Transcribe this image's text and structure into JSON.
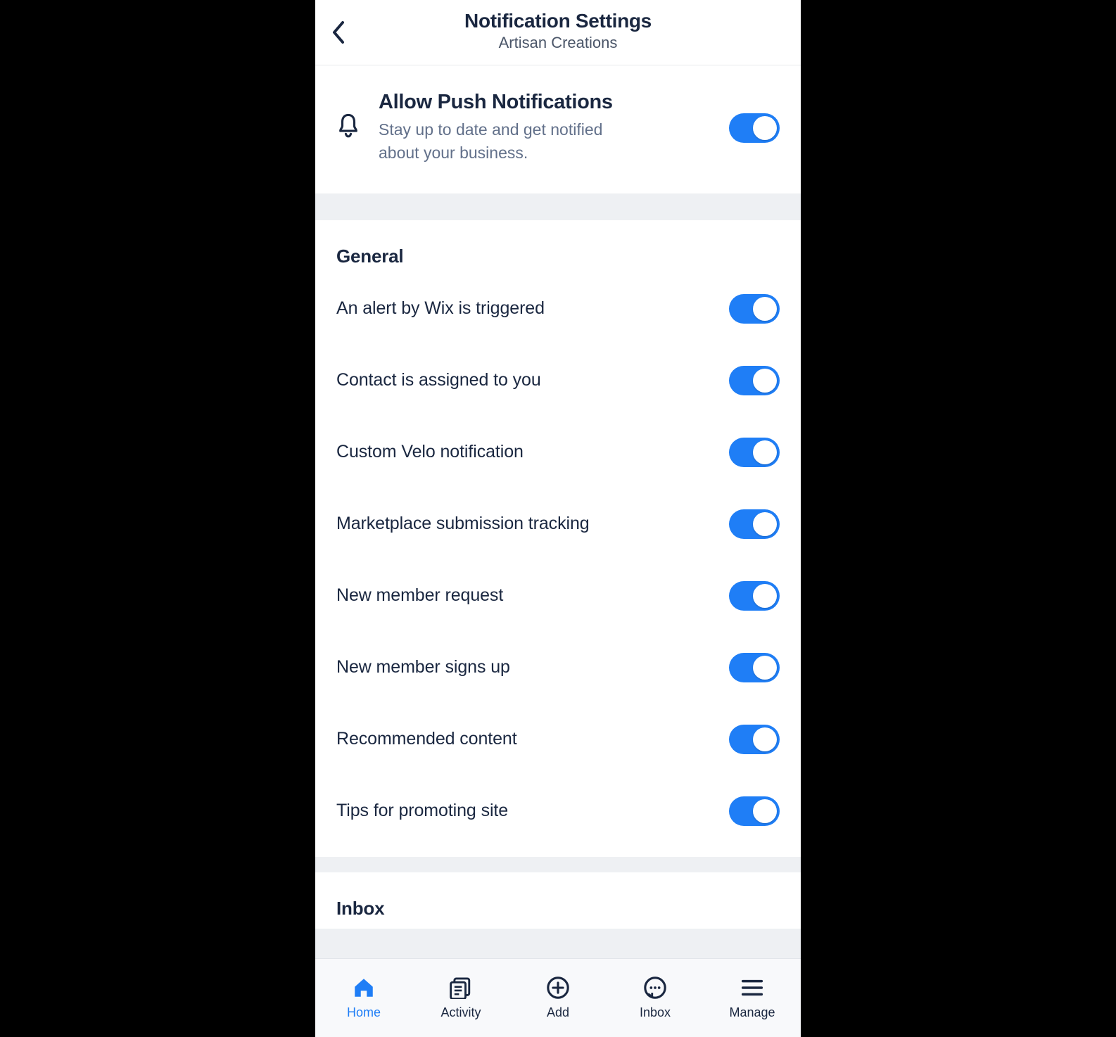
{
  "header": {
    "title": "Notification Settings",
    "subtitle": "Artisan Creations"
  },
  "push": {
    "title": "Allow Push Notifications",
    "description": "Stay up to date and get notified about your business.",
    "enabled": true
  },
  "sections": [
    {
      "title": "General",
      "items": [
        {
          "label": "An alert by Wix is triggered",
          "enabled": true
        },
        {
          "label": "Contact is assigned to you",
          "enabled": true
        },
        {
          "label": "Custom Velo notification",
          "enabled": true
        },
        {
          "label": "Marketplace submission tracking",
          "enabled": true
        },
        {
          "label": "New member request",
          "enabled": true
        },
        {
          "label": "New member signs up",
          "enabled": true
        },
        {
          "label": "Recommended content",
          "enabled": true
        },
        {
          "label": "Tips for promoting site",
          "enabled": true
        }
      ]
    },
    {
      "title": "Inbox",
      "items": []
    }
  ],
  "nav": {
    "home": "Home",
    "activity": "Activity",
    "add": "Add",
    "inbox": "Inbox",
    "manage": "Manage",
    "active": "home"
  }
}
